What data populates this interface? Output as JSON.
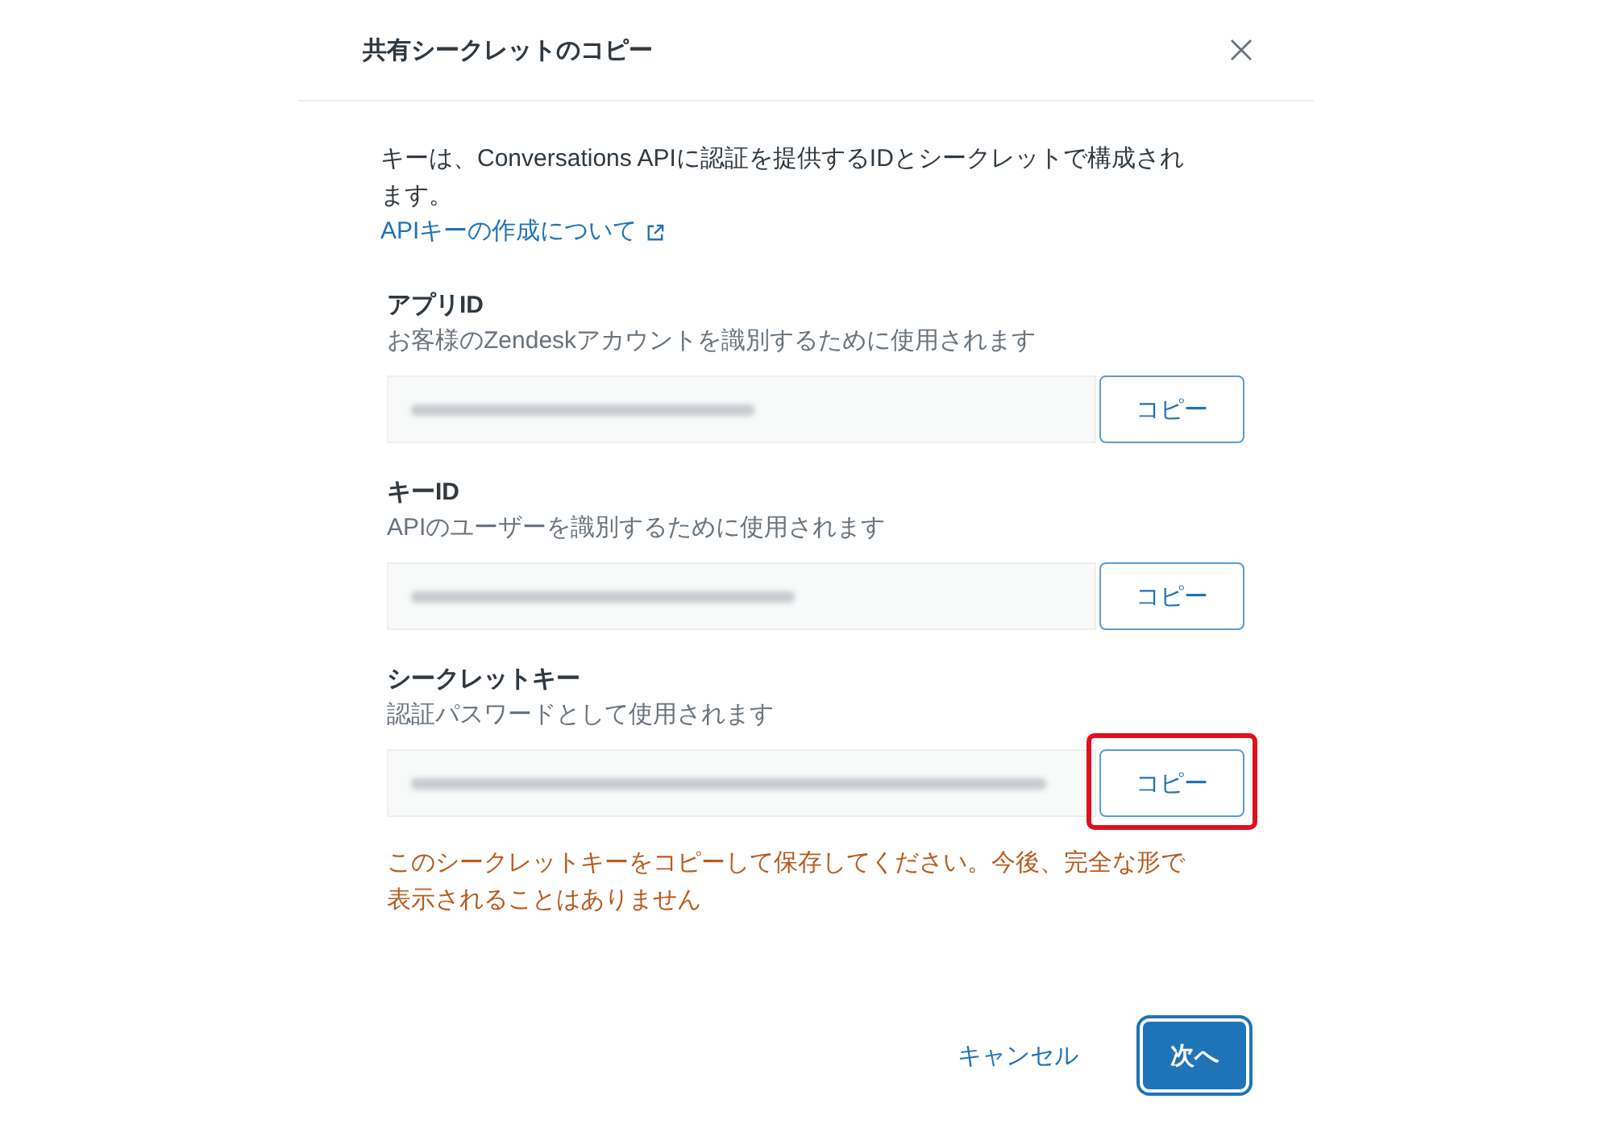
{
  "dialog": {
    "title": "共有シークレットのコピー"
  },
  "intro": {
    "text": "キーは、Conversations APIに認証を提供するIDとシークレットで構成されます。",
    "link": "APIキーの作成について"
  },
  "fields": [
    {
      "label": "アプリID",
      "hint": "お客様のZendeskアカウントを識別するために使用されます",
      "button": "コピー",
      "highlighted": false
    },
    {
      "label": "キーID",
      "hint": "APIのユーザーを識別するために使用されます",
      "button": "コピー",
      "highlighted": false
    },
    {
      "label": "シークレットキー",
      "hint": "認証パスワードとして使用されます",
      "button": "コピー",
      "highlighted": true,
      "warning": "このシークレットキーをコピーして保存してください。今後、完全な形で表示されることはありません"
    }
  ],
  "footer": {
    "buttons": [
      {
        "label": "キャンセル",
        "kind": "link"
      },
      {
        "label": "次へ",
        "kind": "primary"
      }
    ]
  }
}
